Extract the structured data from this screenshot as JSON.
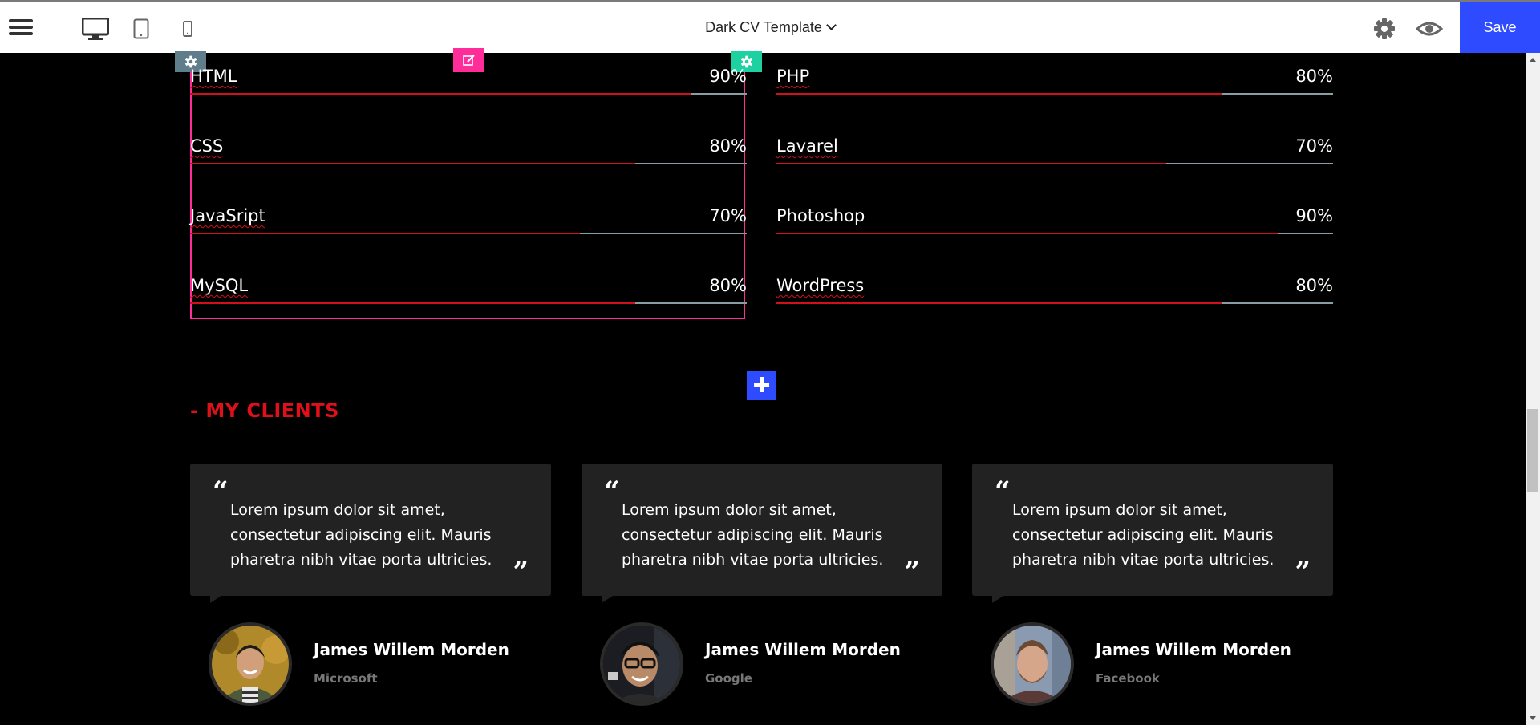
{
  "toolbar": {
    "document_title": "Dark CV Template",
    "save_label": "Save",
    "devices": [
      "desktop",
      "tablet",
      "mobile"
    ]
  },
  "skills": {
    "left": [
      {
        "name": "HTML",
        "percent": 90,
        "label": "90%"
      },
      {
        "name": "CSS",
        "percent": 80,
        "label": "80%"
      },
      {
        "name": "JavaSript",
        "percent": 70,
        "label": "70%"
      },
      {
        "name": "MySQL",
        "percent": 80,
        "label": "80%"
      }
    ],
    "right": [
      {
        "name": "PHP",
        "percent": 80,
        "label": "80%"
      },
      {
        "name": "Lavarel",
        "percent": 70,
        "label": "70%"
      },
      {
        "name": "Photoshop",
        "percent": 90,
        "label": "90%"
      },
      {
        "name": "WordPress",
        "percent": 80,
        "label": "80%"
      }
    ]
  },
  "clients": {
    "title": "- MY CLIENTS",
    "testimonials": [
      {
        "quote": "Lorem ipsum dolor sit amet, consectetur adipiscing elit. Mauris pharetra nibh vitae porta ultricies.",
        "name": "James Willem Morden",
        "company": "Microsoft"
      },
      {
        "quote": "Lorem ipsum dolor sit amet, consectetur adipiscing elit. Mauris pharetra nibh vitae porta ultricies.",
        "name": "James Willem Morden",
        "company": "Google"
      },
      {
        "quote": "Lorem ipsum dolor sit amet, consectetur adipiscing elit. Mauris pharetra nibh vitae porta ultricies.",
        "name": "James Willem Morden",
        "company": "Facebook"
      }
    ]
  },
  "colors": {
    "accent_red": "#d0101a",
    "bar_track": "#8a9da5",
    "save_blue": "#2f4bff",
    "selection_pink": "#ff2d9a",
    "gear_slate": "#607d8b",
    "gear_teal": "#1dd1a1",
    "card_bg": "#222222"
  },
  "icons": [
    "hamburger-menu-icon",
    "desktop-icon",
    "tablet-icon",
    "mobile-icon",
    "settings-gear-icon",
    "preview-eye-icon",
    "edit-icon",
    "plus-icon",
    "quote-open-icon",
    "quote-close-icon"
  ]
}
